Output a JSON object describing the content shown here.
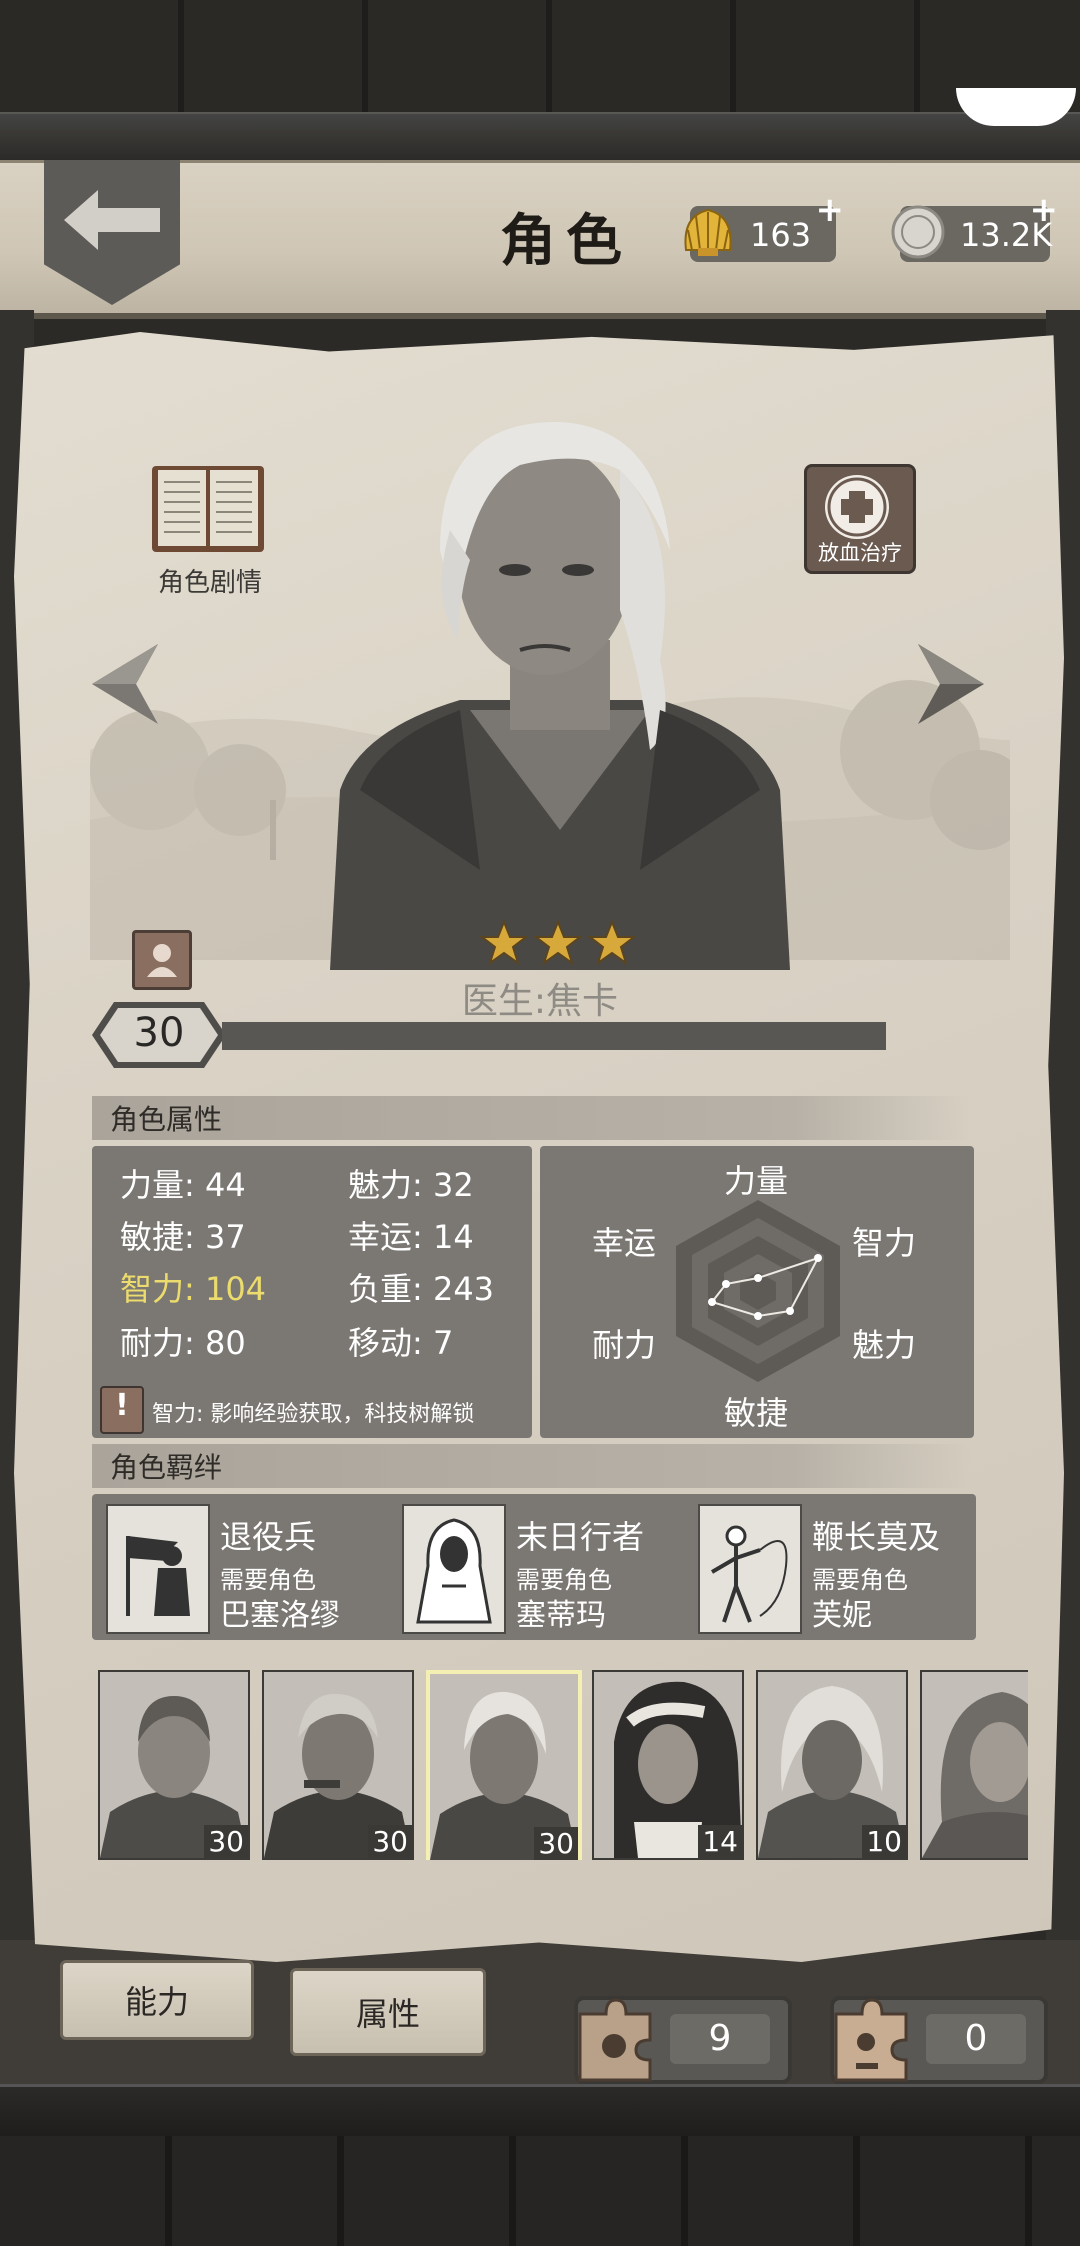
{
  "header": {
    "title": "角色",
    "shells": "163",
    "coins": "13.2K",
    "plus": "+"
  },
  "character": {
    "story_label": "角色剧情",
    "skill_label": "放血治疗",
    "name": "医生:焦卡",
    "stars": 3,
    "level": "30",
    "xp_fraction": 1.0
  },
  "attributes": {
    "title": "角色属性",
    "items": [
      {
        "label": "力量: 44"
      },
      {
        "label": "魅力: 32"
      },
      {
        "label": "敏捷: 37"
      },
      {
        "label": "幸运: 14"
      },
      {
        "label": "智力: 104"
      },
      {
        "label": "负重: 243"
      },
      {
        "label": "耐力: 80"
      },
      {
        "label": "移动: 7"
      }
    ],
    "tip": "智力: 影响经验获取，科技树解锁",
    "radar": {
      "top": "力量",
      "upper_left": "幸运",
      "upper_right": "智力",
      "lower_left": "耐力",
      "lower_right": "魅力",
      "bottom": "敏捷"
    }
  },
  "bonds": {
    "title": "角色羁绊",
    "need": "需要角色",
    "items": [
      {
        "name": "退役兵",
        "req": "巴塞洛缪"
      },
      {
        "name": "末日行者",
        "req": "塞蒂玛"
      },
      {
        "name": "鞭长莫及",
        "req": "芙妮"
      }
    ]
  },
  "roster": [
    {
      "level": "30"
    },
    {
      "level": "30"
    },
    {
      "level": "30"
    },
    {
      "level": "14"
    },
    {
      "level": "10"
    },
    {
      "level": ""
    }
  ],
  "tabs": {
    "ability": "能力",
    "attributes": "属性"
  },
  "fragments": {
    "a": "9",
    "b": "0"
  }
}
